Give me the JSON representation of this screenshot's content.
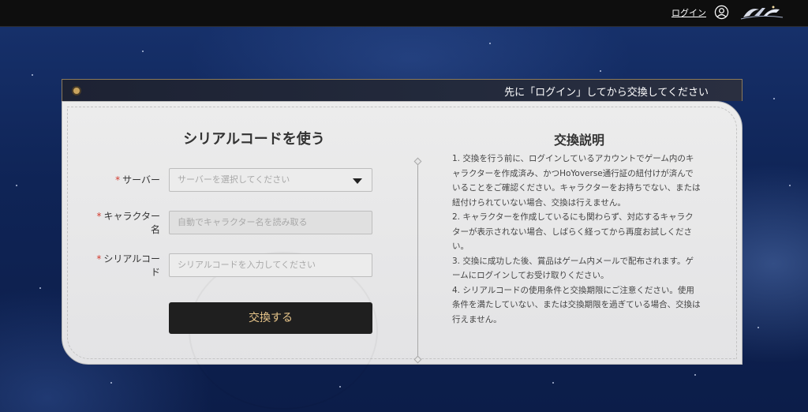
{
  "topbar": {
    "login_label": "ログイン",
    "user_icon": "user-circle-icon",
    "logo_icon": "game-logo"
  },
  "panel": {
    "header_text": "先に「ログイン」してから交換してください"
  },
  "form": {
    "title": "シリアルコードを使う",
    "required_mark": "*",
    "server": {
      "label": "サーバー",
      "placeholder": "サーバーを選択してください"
    },
    "character": {
      "label_line1": "キャラクター",
      "label_line2": "名",
      "placeholder": "自動でキャラクター名を読み取る"
    },
    "code": {
      "label_line1": "シリアルコー",
      "label_line2": "ド",
      "placeholder": "シリアルコードを入力してください"
    },
    "submit_label": "交換する"
  },
  "instructions": {
    "title": "交換説明",
    "items": [
      "1. 交換を行う前に、ログインしているアカウントでゲーム内のキャラクターを作成済み、かつHoYoverse通行証の紐付けが済んでいることをご確認ください。キャラクターをお持ちでない、または紐付けられていない場合、交換は行えません。",
      "2. キャラクターを作成しているにも関わらず、対応するキャラクターが表示されない場合、しばらく経ってから再度お試しください。",
      "3. 交換に成功した後、賞品はゲーム内メールで配布されます。ゲームにログインしてお受け取りください。",
      "4. シリアルコードの使用条件と交換期限にご注意ください。使用条件を満たしていない、または交換期限を過ぎている場合、交換は行えません。"
    ]
  },
  "colors": {
    "accent_text": "#e7c58a",
    "required": "#d33b2f",
    "topbar": "#0e0e0e"
  }
}
